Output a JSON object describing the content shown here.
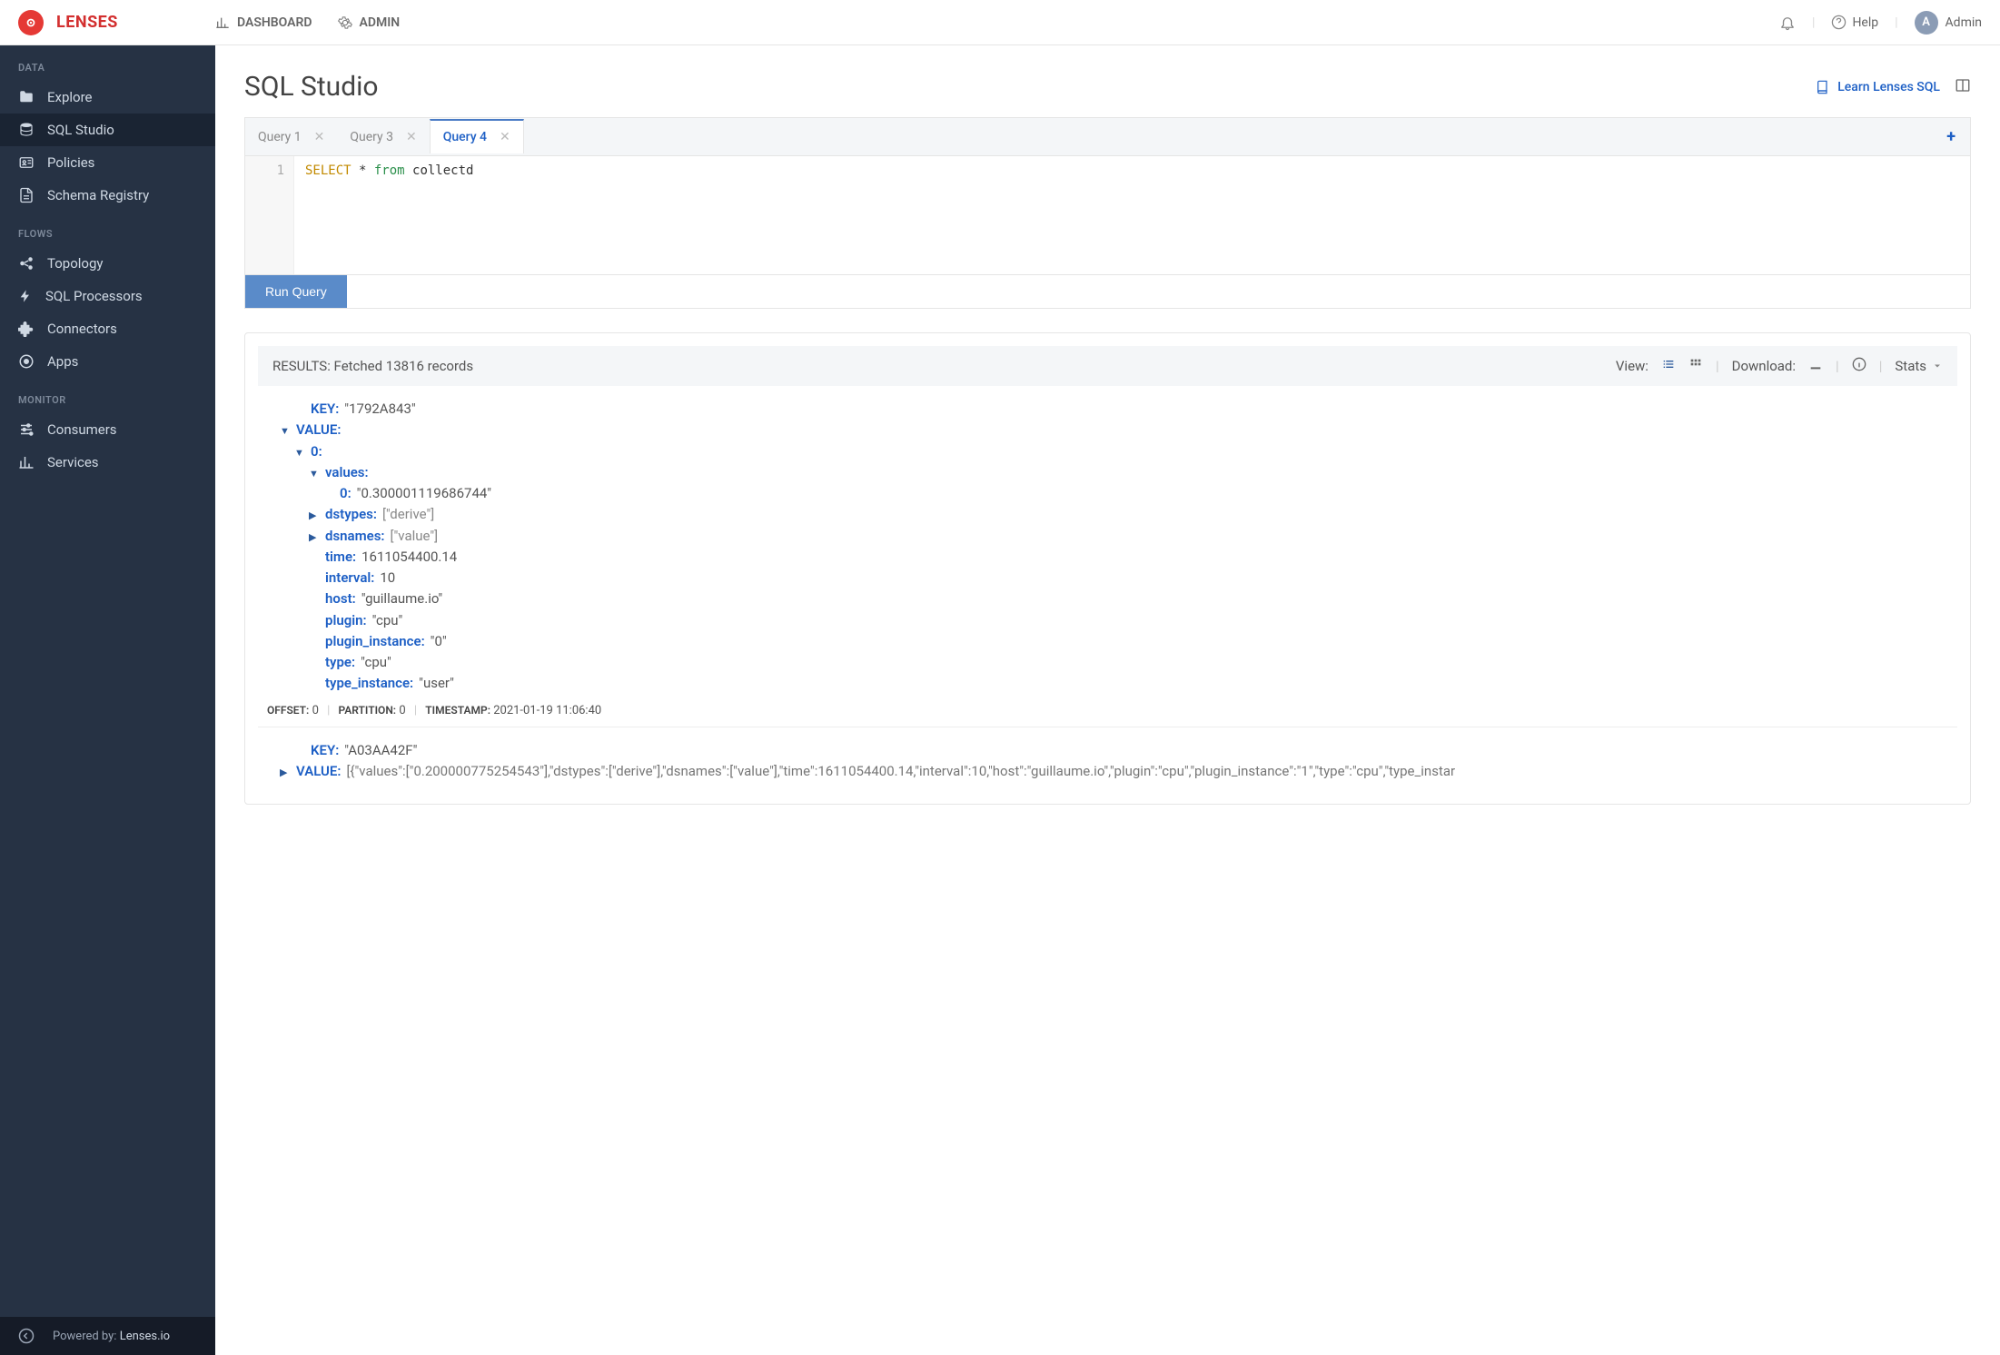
{
  "brand": "LENSES",
  "header": {
    "dashboard": "DASHBOARD",
    "admin": "ADMIN",
    "help": "Help",
    "user_initial": "A",
    "user_name": "Admin"
  },
  "sidebar": {
    "section_data": "DATA",
    "section_flows": "FLOWS",
    "section_monitor": "MONITOR",
    "data_items": [
      "Explore",
      "SQL Studio",
      "Policies",
      "Schema Registry"
    ],
    "flows_items": [
      "Topology",
      "SQL Processors",
      "Connectors",
      "Apps"
    ],
    "monitor_items": [
      "Consumers",
      "Services"
    ],
    "footer_prefix": "Powered by: ",
    "footer_brand": "Lenses.io"
  },
  "page": {
    "title": "SQL Studio",
    "learn_link": "Learn Lenses SQL"
  },
  "tabs": {
    "items": [
      "Query 1",
      "Query 3",
      "Query 4"
    ],
    "active_index": 2
  },
  "editor": {
    "line_number": "1",
    "code_select": "SELECT",
    "code_star": " * ",
    "code_from": "from",
    "code_table": " collectd",
    "run_label": "Run Query"
  },
  "results": {
    "label": "RESULTS: Fetched 13816 records",
    "view_label": "View:",
    "download_label": "Download:",
    "stats_label": "Stats"
  },
  "record1": {
    "key_label": "KEY:",
    "key_value": "\"1792A843\"",
    "value_label": "VALUE:",
    "idx0": "0:",
    "values_label": "values:",
    "values_idx": "0:",
    "values_val": "\"0.300001119686744\"",
    "dstypes_label": "dstypes:",
    "dstypes_val": "[\"derive\"]",
    "dsnames_label": "dsnames:",
    "dsnames_val": "[\"value\"]",
    "time_label": "time:",
    "time_val": "1611054400.14",
    "interval_label": "interval:",
    "interval_val": "10",
    "host_label": "host:",
    "host_val": "\"guillaume.io\"",
    "plugin_label": "plugin:",
    "plugin_val": "\"cpu\"",
    "plugin_instance_label": "plugin_instance:",
    "plugin_instance_val": "\"0\"",
    "type_label": "type:",
    "type_val": "\"cpu\"",
    "type_instance_label": "type_instance:",
    "type_instance_val": "\"user\"",
    "offset_label": "OFFSET:",
    "offset_val": "0",
    "partition_label": "PARTITION:",
    "partition_val": "0",
    "timestamp_label": "TIMESTAMP:",
    "timestamp_val": "2021-01-19 11:06:40"
  },
  "record2": {
    "key_label": "KEY:",
    "key_value": "\"A03AA42F\"",
    "value_label": "VALUE:",
    "value_collapsed": "[{\"values\":[\"0.200000775254543\"],\"dstypes\":[\"derive\"],\"dsnames\":[\"value\"],\"time\":1611054400.14,\"interval\":10,\"host\":\"guillaume.io\",\"plugin\":\"cpu\",\"plugin_instance\":\"1\",\"type\":\"cpu\",\"type_instar"
  }
}
